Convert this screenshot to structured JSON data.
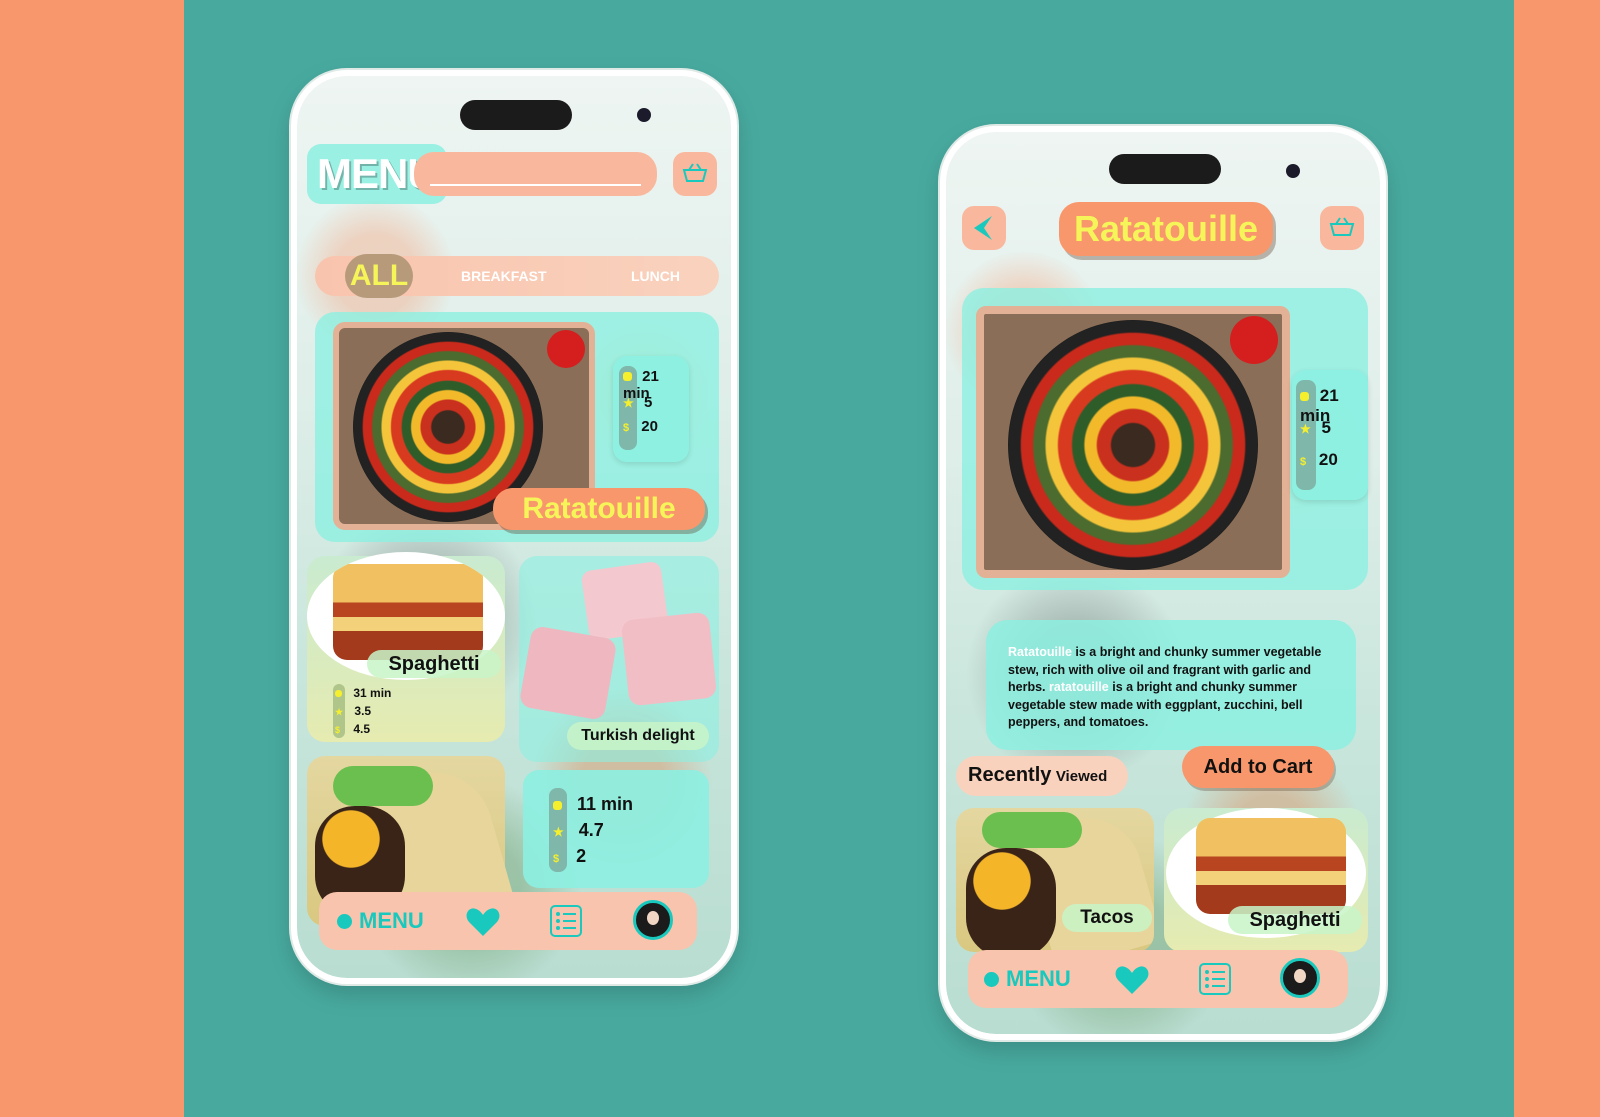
{
  "colors": {
    "teal": "#48AA9F",
    "peach": "#F9976C",
    "mint": "#8CF0E1",
    "yellow": "#F5F55A",
    "accent": "#19C9BD"
  },
  "menu_screen": {
    "header": {
      "title": "MENU",
      "search_placeholder": ""
    },
    "categories": [
      "ALL",
      "BREAKFAST",
      "LUNCH"
    ],
    "featured": {
      "name": "Ratatouille",
      "time": "21 min",
      "rating": "5",
      "price": "20"
    },
    "cards": [
      {
        "name": "Spaghetti",
        "time": "31 min",
        "rating": "3.5",
        "price": "4.5"
      },
      {
        "name": "Turkish delight"
      },
      {
        "name": "",
        "time": "11 min",
        "rating": "4.7",
        "price": "2"
      }
    ],
    "nav": {
      "label": "MENU",
      "icons": [
        "heart-icon",
        "list-icon",
        "avatar"
      ]
    }
  },
  "detail_screen": {
    "title": "Ratatouille",
    "stats": {
      "time": "21 min",
      "rating": "5",
      "price": "20"
    },
    "description": {
      "highlight_1": "Ratatouille",
      "text_1": " is a bright and chunky summer vegetable stew, rich with olive oil and fragrant with garlic and herbs. ",
      "highlight_2": "ratatouille",
      "text_2": " is a bright and chunky summer vegetable stew made with eggplant, zucchini, bell peppers, and tomatoes."
    },
    "recently_viewed": {
      "label_main": "Recently",
      "label_small": "Viewed"
    },
    "add_to_cart": "Add to Cart",
    "recent_items": [
      "Tacos",
      "Spaghetti"
    ],
    "nav": {
      "label": "MENU"
    }
  }
}
